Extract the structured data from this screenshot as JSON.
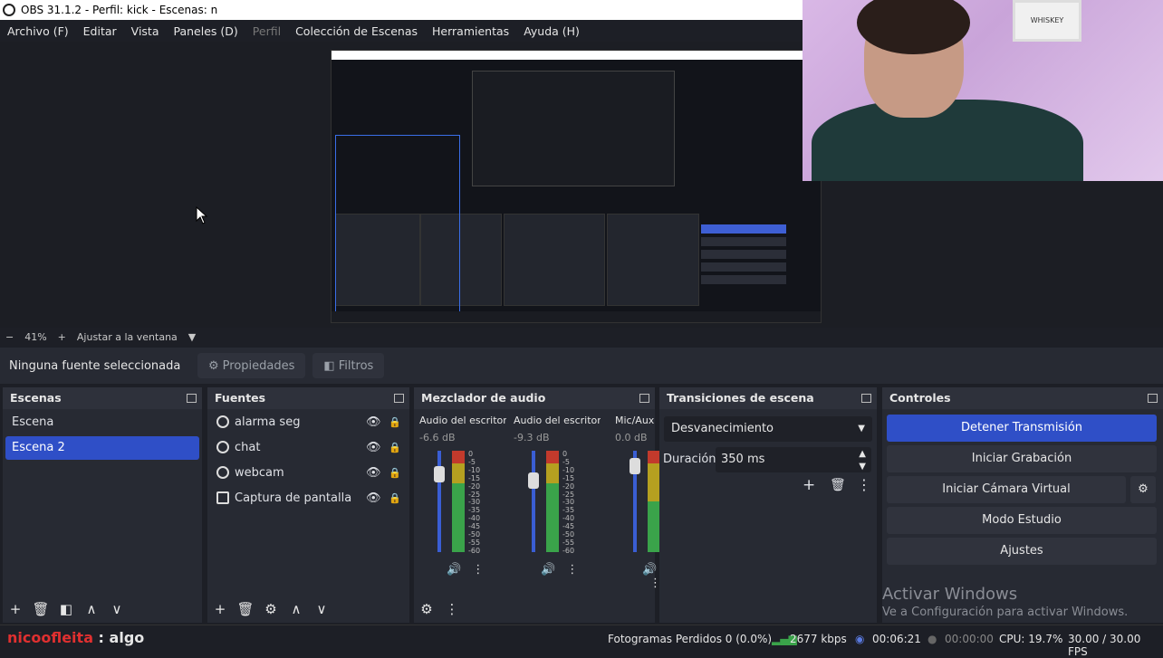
{
  "window": {
    "title": "OBS 31.1.2 - Perfil: kick - Escenas: n"
  },
  "menu": [
    "Archivo (F)",
    "Editar",
    "Vista",
    "Paneles (D)",
    "Perfil",
    "Colección de Escenas",
    "Herramientas",
    "Ayuda (H)"
  ],
  "scale": {
    "minus": "−",
    "zoom": "41%",
    "plus": "+",
    "fit": "Ajustar a la ventana",
    "arrow": "▼"
  },
  "props": {
    "no_source": "Ninguna fuente seleccionada",
    "properties": "Propiedades",
    "filters": "Filtros"
  },
  "scenes": {
    "title": "Escenas",
    "items": [
      "Escena",
      "Escena 2"
    ],
    "selected": 1
  },
  "sources": {
    "title": "Fuentes",
    "items": [
      {
        "name": "alarma seg",
        "icon": "globe-icon"
      },
      {
        "name": "chat",
        "icon": "globe-icon"
      },
      {
        "name": "webcam",
        "icon": "globe-icon"
      },
      {
        "name": "Captura de pantalla",
        "icon": "monitor-icon"
      }
    ]
  },
  "mixer": {
    "title": "Mezclador de audio",
    "channels": [
      {
        "name": "Audio del escritorio",
        "db": "-6.6 dB",
        "level": 0.68,
        "fader": 0.82
      },
      {
        "name": "Audio del escritorio",
        "db": "-9.3 dB",
        "level": 0.68,
        "fader": 0.74
      },
      {
        "name": "Mic/Aux",
        "db": "0.0 dB",
        "level": 0.5,
        "fader": 0.92
      }
    ],
    "ticks": [
      "0",
      "-5",
      "-10",
      "-15",
      "-20",
      "-25",
      "-30",
      "-35",
      "-40",
      "-45",
      "-50",
      "-55",
      "-60"
    ]
  },
  "transitions": {
    "title": "Transiciones de escena",
    "type": "Desvanecimiento",
    "duration_label": "Duración",
    "duration": "350 ms"
  },
  "controls": {
    "title": "Controles",
    "buttons": [
      "Detener Transmisión",
      "Iniciar Grabación",
      "Iniciar Cámara Virtual",
      "Modo Estudio",
      "Ajustes"
    ]
  },
  "watermark": {
    "line1": "Activar Windows",
    "line2": "Ve a Configuración para activar Windows."
  },
  "overlay": {
    "name": "nicoofleita",
    "sep": " : ",
    "text": "algo"
  },
  "status": {
    "dropped": "Fotogramas Perdidos 0 (0.0%)",
    "kbps": "2677 kbps",
    "stream_time": "00:06:21",
    "rec_time": "00:00:00",
    "cpu": "CPU: 19.7%",
    "fps": "30.00 / 30.00 FPS"
  },
  "webcam": {
    "poster": "WHISKEY"
  },
  "colors": {
    "accent": "#2f4fc7",
    "panel": "#272a33",
    "meter_green": "#3aa34a",
    "meter_red": "#c23a2c"
  }
}
